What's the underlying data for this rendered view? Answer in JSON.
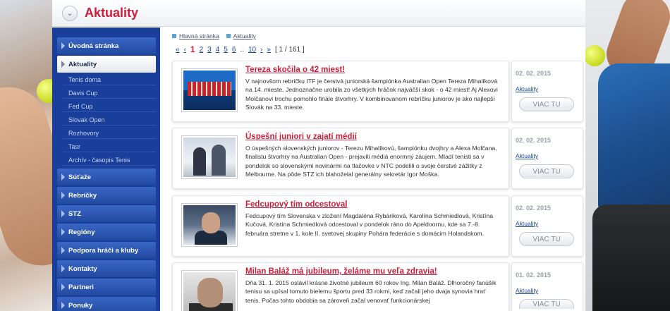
{
  "header": {
    "title": "Aktuality"
  },
  "sidebar": {
    "items": [
      {
        "label": "Úvodná stránka"
      },
      {
        "label": "Aktuality"
      },
      {
        "label": "Súťaže"
      },
      {
        "label": "Rebríčky"
      },
      {
        "label": "STZ"
      },
      {
        "label": "Regióny"
      },
      {
        "label": "Podpora hráči a kluby"
      },
      {
        "label": "Kontakty"
      },
      {
        "label": "Partneri"
      },
      {
        "label": "Ponuky"
      }
    ],
    "subitems": [
      {
        "label": "Tenis doma"
      },
      {
        "label": "Davis Cup"
      },
      {
        "label": "Fed Cup"
      },
      {
        "label": "Slovak Open"
      },
      {
        "label": "Rozhovory"
      },
      {
        "label": "Tasr"
      },
      {
        "label": "Archív - časopis Tenis"
      }
    ]
  },
  "breadcrumb": {
    "home": "Hlavná stránka",
    "current": "Aktuality"
  },
  "pager": {
    "first": "«",
    "prev": "‹",
    "pages": [
      "1",
      "2",
      "3",
      "4",
      "5",
      "6"
    ],
    "ellipsis": "..",
    "last_page": "10",
    "next": "›",
    "last": "»",
    "position": "[ 1 / 161 ]"
  },
  "articles": [
    {
      "title": "Tereza skočila o 42 miest!",
      "text": "V najnovšom rebríčku ITF je čerstvá juniorská šampiónka Australian Open Tereza Mihalíková na 14. mieste. Jednoznačne urobila zo všetkých hráčok najväčší skok - o 42 miest! Aj Alexovi Molčanovi trochu pomohlo finále štvorhry. V kombinovanom rebríčku juniorov je ako najlepší Slovák na 33. mieste.",
      "date": "02. 02. 2015",
      "category": "Aktuality",
      "more": "VIAC TU"
    },
    {
      "title": "Úspešní juniori v zajatí médií",
      "text": "O úspešných slovenských juniorov - Terezu Mihalíkovú, šampiónku dvojhry a Alexa Molčana, finalistu štvorhry na Australian Open - prejavili médiá enormný záujem. Mladí tenisti sa v pondelok so slovenskými novinármi na tlačovke v NTC podelili o svoje čerstvé zážitky z Melbourne. Na pôde STZ ich blahoželal generálny sekretár Igor Moška.",
      "date": "02. 02. 2015",
      "category": "Aktuality",
      "more": "VIAC TU"
    },
    {
      "title": "Fedcupový tím odcestoval",
      "text": "Fedcupový tím Slovenska v zložení Magdaléna Rybáriková, Karolína Schmiedlová, Kristína Kučová, Kristína Schmiedlová odcestoval v pondelok ráno do Apeldoornu, kde sa 7.-8. februára stretne v 1. kole II. svetovej skupiny Pohára federácie s domácim Holandskom.",
      "date": "02. 02. 2015",
      "category": "Aktuality",
      "more": "VIAC TU"
    },
    {
      "title": "Milan Baláž má jubileum, želáme mu veľa zdravia!",
      "text": "Dňa 31. 1. 2015 oslávil krásne životné jubileum 60 rokov Ing. Milan Baláž. Dlhoročný fanúšik tenisu sa upísal tomuto bielemu športu pred 33 rokmi, keď začali jeho dvaja synovia hrať tenis. Počas tohto obdobia sa zároveň začal venovať funkcionárskej",
      "date": "01. 02. 2015",
      "category": "Aktuality",
      "more": "VIAC TU"
    }
  ]
}
